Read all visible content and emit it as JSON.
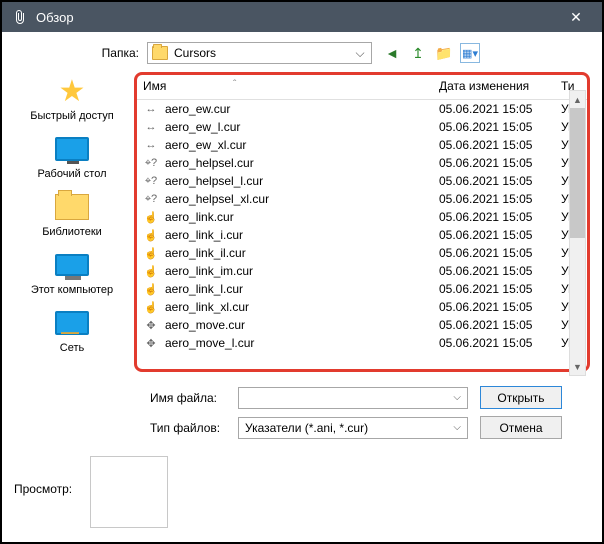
{
  "window": {
    "title": "Обзор"
  },
  "folder": {
    "label": "Папка:",
    "name": "Cursors"
  },
  "columns": {
    "name": "Имя",
    "date": "Дата изменения",
    "type": "Ти"
  },
  "places": [
    {
      "label": "Быстрый доступ"
    },
    {
      "label": "Рабочий стол"
    },
    {
      "label": "Библиотеки"
    },
    {
      "label": "Этот компьютер"
    },
    {
      "label": "Сеть"
    }
  ],
  "files": [
    {
      "name": "aero_ew.cur",
      "date": "05.06.2021 15:05",
      "type": "Ук"
    },
    {
      "name": "aero_ew_l.cur",
      "date": "05.06.2021 15:05",
      "type": "Ук"
    },
    {
      "name": "aero_ew_xl.cur",
      "date": "05.06.2021 15:05",
      "type": "Ук"
    },
    {
      "name": "aero_helpsel.cur",
      "date": "05.06.2021 15:05",
      "type": "Ук"
    },
    {
      "name": "aero_helpsel_l.cur",
      "date": "05.06.2021 15:05",
      "type": "Ук"
    },
    {
      "name": "aero_helpsel_xl.cur",
      "date": "05.06.2021 15:05",
      "type": "Ук"
    },
    {
      "name": "aero_link.cur",
      "date": "05.06.2021 15:05",
      "type": "Ук"
    },
    {
      "name": "aero_link_i.cur",
      "date": "05.06.2021 15:05",
      "type": "Ук"
    },
    {
      "name": "aero_link_il.cur",
      "date": "05.06.2021 15:05",
      "type": "Ук"
    },
    {
      "name": "aero_link_im.cur",
      "date": "05.06.2021 15:05",
      "type": "Ук"
    },
    {
      "name": "aero_link_l.cur",
      "date": "05.06.2021 15:05",
      "type": "Ук"
    },
    {
      "name": "aero_link_xl.cur",
      "date": "05.06.2021 15:05",
      "type": "Ук"
    },
    {
      "name": "aero_move.cur",
      "date": "05.06.2021 15:05",
      "type": "Ук"
    },
    {
      "name": "aero_move_l.cur",
      "date": "05.06.2021 15:05",
      "type": "Ук"
    }
  ],
  "form": {
    "file_label": "Имя файла:",
    "file_value": "",
    "type_label": "Тип файлов:",
    "type_value": "Указатели (*.ani, *.cur)",
    "open": "Открыть",
    "cancel": "Отмена"
  },
  "preview": {
    "label": "Просмотр:"
  }
}
